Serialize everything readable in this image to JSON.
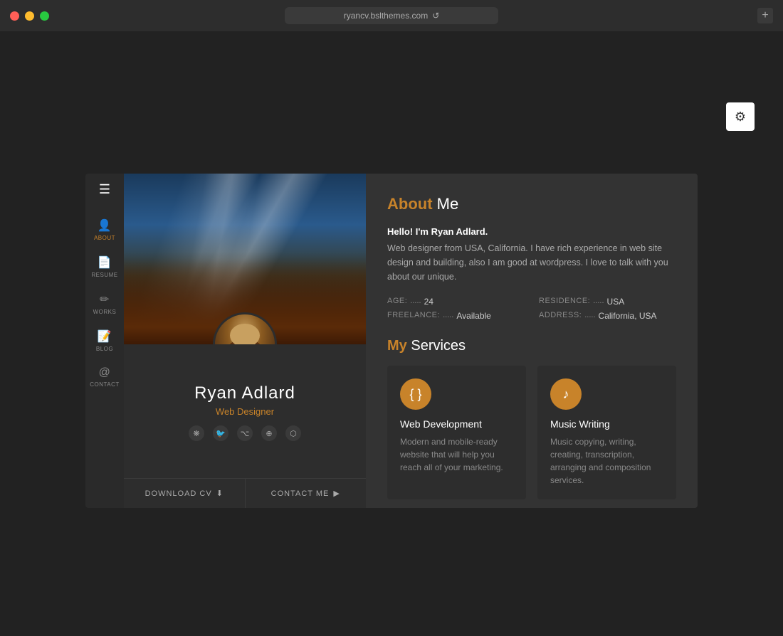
{
  "browser": {
    "url": "ryancv.bslthemes.com",
    "new_tab_label": "+"
  },
  "gear_icon": "⚙",
  "sidebar": {
    "menu_icon": "☰",
    "items": [
      {
        "id": "about",
        "icon": "👤",
        "label": "ABOUT",
        "active": true
      },
      {
        "id": "resume",
        "icon": "📄",
        "label": "RESUME",
        "active": false
      },
      {
        "id": "works",
        "icon": "✏️",
        "label": "WORKS",
        "active": false
      },
      {
        "id": "blog",
        "icon": "📝",
        "label": "BLOG",
        "active": false
      },
      {
        "id": "contact",
        "icon": "@",
        "label": "CONTACT",
        "active": false
      }
    ]
  },
  "profile": {
    "name": "Ryan Adlard",
    "title": "Web Designer",
    "social": [
      "❋",
      "🐦",
      "⌥",
      "⊕",
      "⬡"
    ],
    "download_cv": "DOWNLOAD CV",
    "contact_me": "CONTACT ME"
  },
  "about": {
    "section_title_highlight": "About",
    "section_title_rest": " Me",
    "intro_bold": "Hello! I'm Ryan Adlard.",
    "intro_text": "Web designer from USA, California. I have rich experience in web site design and building, also I am good at wordpress. I love to talk with you about our unique.",
    "fields": [
      {
        "label": "AGE:",
        "dots": ".....",
        "value": "24"
      },
      {
        "label": "RESIDENCE:",
        "dots": ".....",
        "value": "USA"
      },
      {
        "label": "FREELANCE:",
        "dots": ".....",
        "value": "Available"
      },
      {
        "label": "ADDRESS:",
        "dots": ".....",
        "value": "California, USA"
      }
    ]
  },
  "services": {
    "section_title_highlight": "My",
    "section_title_rest": " Services",
    "items": [
      {
        "icon": "< >",
        "name": "Web Development",
        "description": "Modern and mobile-ready website that will help you reach all of your marketing."
      },
      {
        "icon": "♪",
        "name": "Music Writing",
        "description": "Music copying, writing, creating, transcription, arranging and composition services."
      }
    ]
  }
}
